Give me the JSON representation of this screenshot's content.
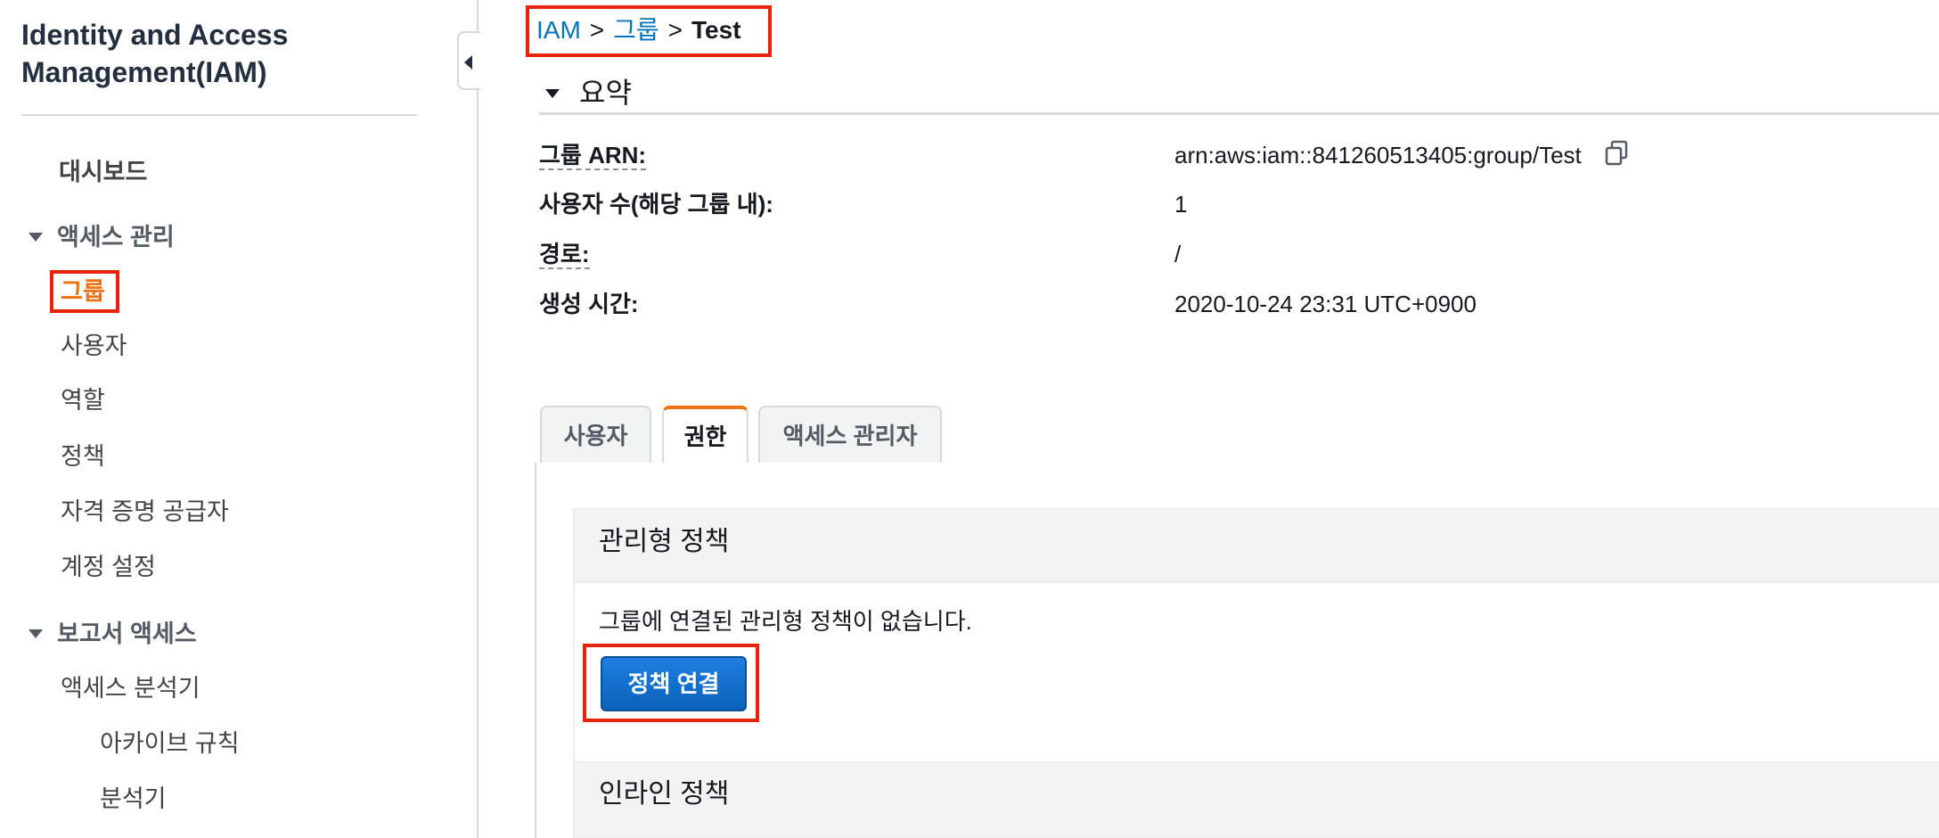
{
  "sidebar": {
    "title": "Identity and Access Management(IAM)",
    "dashboard": "대시보드",
    "access_management": {
      "label": "액세스 관리",
      "items": [
        "그룹",
        "사용자",
        "역할",
        "정책",
        "자격 증명 공급자",
        "계정 설정"
      ]
    },
    "access_reports": {
      "label": "보고서 액세스",
      "analyzer": "액세스 분석기",
      "sub_items": [
        "아카이브 규칙",
        "분석기"
      ]
    },
    "active_item": "그룹"
  },
  "breadcrumb": {
    "root": "IAM",
    "sep1": ">",
    "section": "그룹",
    "sep2": ">",
    "current": "Test"
  },
  "summary": {
    "title": "요약",
    "fields": [
      {
        "label": "그룹 ARN:",
        "value": "arn:aws:iam::841260513405:group/Test"
      },
      {
        "label": "사용자 수(해당 그룹 내):",
        "value": "1"
      },
      {
        "label": "경로:",
        "value": "/"
      },
      {
        "label": "생성 시간:",
        "value": "2020-10-24 23:31 UTC+0900"
      }
    ]
  },
  "tabs": [
    {
      "label": "사용자"
    },
    {
      "label": "권한"
    },
    {
      "label": "액세스 관리자"
    }
  ],
  "active_tab": "권한",
  "permissions": {
    "managed_title": "관리형 정책",
    "empty_message": "그룹에 연결된 관리형 정책이 없습니다.",
    "attach_button": "정책 연결",
    "inline_title": "인라인 정책"
  },
  "colors": {
    "link": "#0073bb",
    "active_nav": "#ec7211",
    "highlight_box": "#e8230c",
    "primary_button": "#1e7ee0"
  }
}
